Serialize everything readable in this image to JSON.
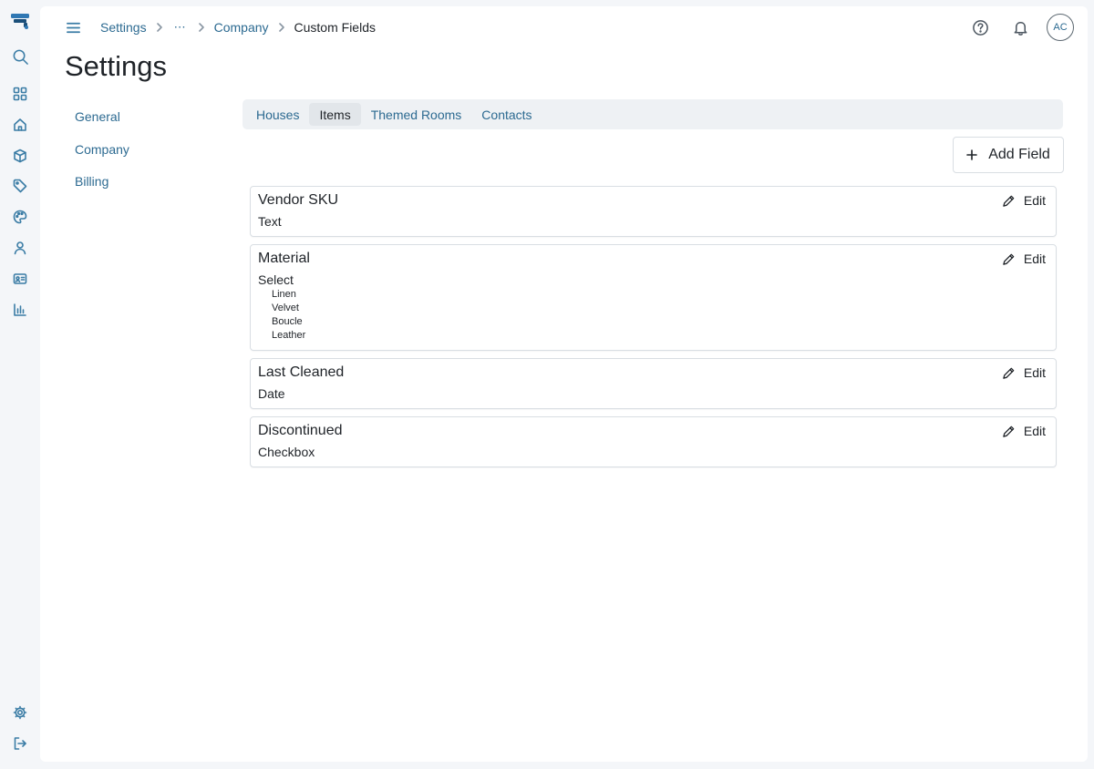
{
  "breadcrumb": {
    "items": [
      "Settings",
      "Company",
      "Custom Fields"
    ],
    "more": "⋯"
  },
  "header": {
    "avatar_initials": "AC"
  },
  "page": {
    "title": "Settings"
  },
  "side_nav": {
    "items": [
      "General",
      "Company",
      "Billing"
    ]
  },
  "tabs": {
    "items": [
      "Houses",
      "Items",
      "Themed Rooms",
      "Contacts"
    ],
    "active": "Items"
  },
  "actions": {
    "add_field_label": "Add Field",
    "edit_label": "Edit"
  },
  "fields": [
    {
      "name": "Vendor SKU",
      "type": "Text",
      "options": []
    },
    {
      "name": "Material",
      "type": "Select",
      "options": [
        "Linen",
        "Velvet",
        "Boucle",
        "Leather"
      ]
    },
    {
      "name": "Last Cleaned",
      "type": "Date",
      "options": []
    },
    {
      "name": "Discontinued",
      "type": "Checkbox",
      "options": []
    }
  ],
  "colors": {
    "accent": "#3a7ca5",
    "link": "#2c6a91",
    "logo_top": "#2f77b3",
    "logo_bottom": "#1b4f7a"
  },
  "icons": {
    "rail": [
      "logo-icon",
      "search-icon",
      "grid-icon",
      "home-icon",
      "box-icon",
      "tag-icon",
      "palette-icon",
      "user-icon",
      "id-card-icon",
      "chart-icon",
      "gear-icon",
      "logout-icon"
    ],
    "header": [
      "menu-icon",
      "help-icon",
      "bell-icon"
    ]
  }
}
